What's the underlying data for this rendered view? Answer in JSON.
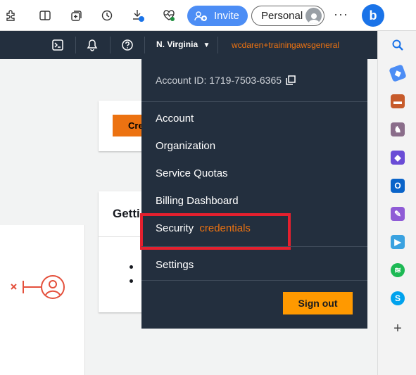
{
  "browser": {
    "invite_label": "Invite",
    "personal_label": "Personal",
    "more_label": "···"
  },
  "aws_nav": {
    "region": "N. Virginia",
    "account_name": "wcdaren+trainingawsgeneral"
  },
  "page": {
    "create_button": "Cre",
    "getting_started_title": "Getti"
  },
  "account_menu": {
    "account_id": "Account ID: 1719-7503-6365",
    "items": [
      {
        "label": "Account"
      },
      {
        "label": "Organization"
      },
      {
        "label": "Service Quotas"
      },
      {
        "label": "Billing Dashboard"
      },
      {
        "label": "Security",
        "accent": "credentials"
      },
      {
        "label": "Settings"
      }
    ],
    "sign_out": "Sign out"
  },
  "colors": {
    "aws_nav_bg": "#232f3e",
    "aws_orange": "#ec7211",
    "signout_bg": "#ff9900",
    "highlight_red": "#e4202e",
    "invite_blue": "#4c8df5"
  },
  "icons": {
    "browser_toolbar": [
      "extensions-icon",
      "split-screen-icon",
      "collections-icon",
      "history-icon",
      "downloads-icon",
      "browser-health-icon"
    ],
    "sidebar": [
      "search-icon",
      "tag-icon",
      "toolbox-icon",
      "chess-icon",
      "copilot-icon",
      "outlook-icon",
      "designer-icon",
      "telegram-icon",
      "spotify-icon",
      "skype-icon",
      "add-icon"
    ]
  }
}
